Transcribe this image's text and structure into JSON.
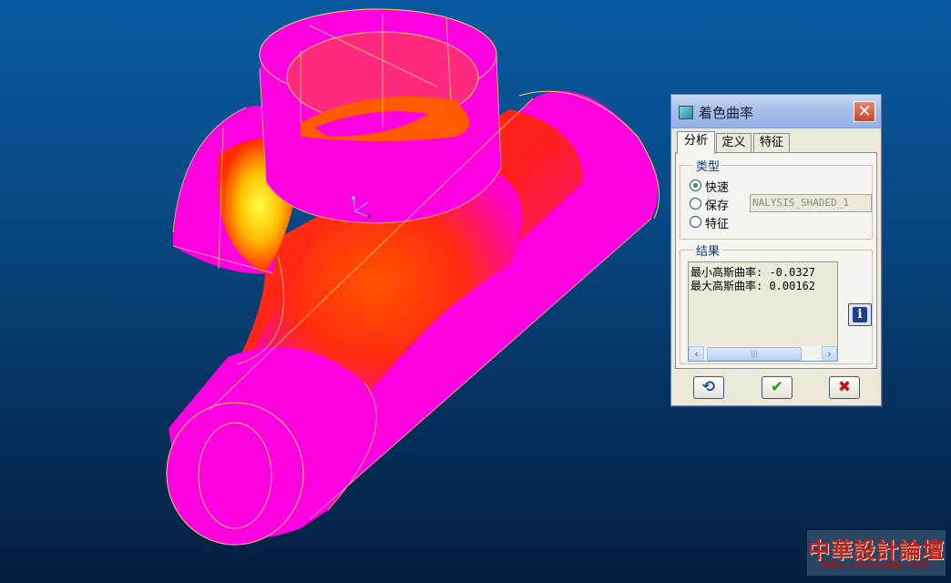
{
  "viewport": {
    "background_top": "#0a5aa0",
    "background_bottom": "#031f40",
    "model_color": "#ff00e0",
    "curvature_colors": [
      "#ff2a10",
      "#ffcc00",
      "#ffff30"
    ]
  },
  "dialog": {
    "title": "着色曲率",
    "close_label": "✕",
    "tabs": [
      {
        "label": "分析",
        "active": true
      },
      {
        "label": "定义",
        "active": false
      },
      {
        "label": "特征",
        "active": false
      }
    ],
    "type_group": {
      "label": "类型",
      "options": [
        {
          "label": "快速",
          "checked": true
        },
        {
          "label": "保存",
          "checked": false
        },
        {
          "label": "特征",
          "checked": false
        }
      ],
      "save_name": "NALYSIS_SHADED_1"
    },
    "results_group": {
      "label": "结果",
      "lines": [
        "最小高斯曲率: -0.0327",
        "最大高斯曲率: 0.00162"
      ],
      "info_icon": "info-icon"
    },
    "buttons": [
      {
        "name": "repaint",
        "symbol": "⟲"
      },
      {
        "name": "ok",
        "symbol": "✔"
      },
      {
        "name": "cancel",
        "symbol": "✖"
      }
    ]
  },
  "watermark": {
    "text": "中華設計論壇",
    "url": "bbs.chinade.net"
  }
}
